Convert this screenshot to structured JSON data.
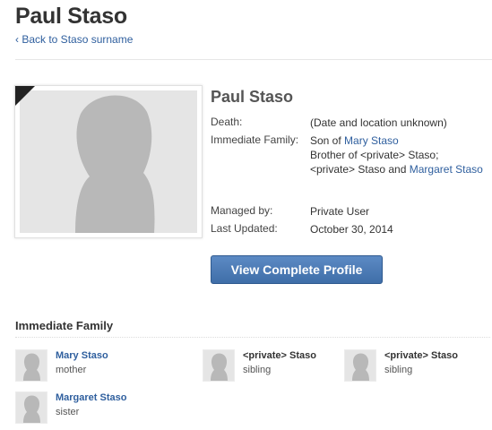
{
  "page": {
    "title": "Paul Staso",
    "back_link": "‹ Back to Staso surname"
  },
  "profile": {
    "name": "Paul Staso",
    "death_label": "Death:",
    "death_value": "(Date and location unknown)",
    "family_label": "Immediate Family:",
    "son_of_prefix": "Son of",
    "son_of_link": "Mary Staso",
    "brother_line": "Brother of <private> Staso;",
    "siblings_prefix": "<private> Staso and",
    "siblings_link": "Margaret Staso",
    "managed_label": "Managed by:",
    "managed_value": "Private User",
    "updated_label": "Last Updated:",
    "updated_value": "October 30, 2014",
    "button_label": "View Complete Profile"
  },
  "immediate_family": {
    "heading": "Immediate Family",
    "members": [
      {
        "name": "Mary Staso",
        "relation": "mother",
        "linked": true
      },
      {
        "name": "<private> Staso",
        "relation": "sibling",
        "linked": false
      },
      {
        "name": "<private> Staso",
        "relation": "sibling",
        "linked": false
      },
      {
        "name": "Margaret Staso",
        "relation": "sister",
        "linked": true
      }
    ]
  },
  "colors": {
    "link": "#2f5f9e",
    "button": "#4a78b4",
    "silhouette": "#b8b8b8",
    "photo_bg": "#e5e5e5"
  }
}
